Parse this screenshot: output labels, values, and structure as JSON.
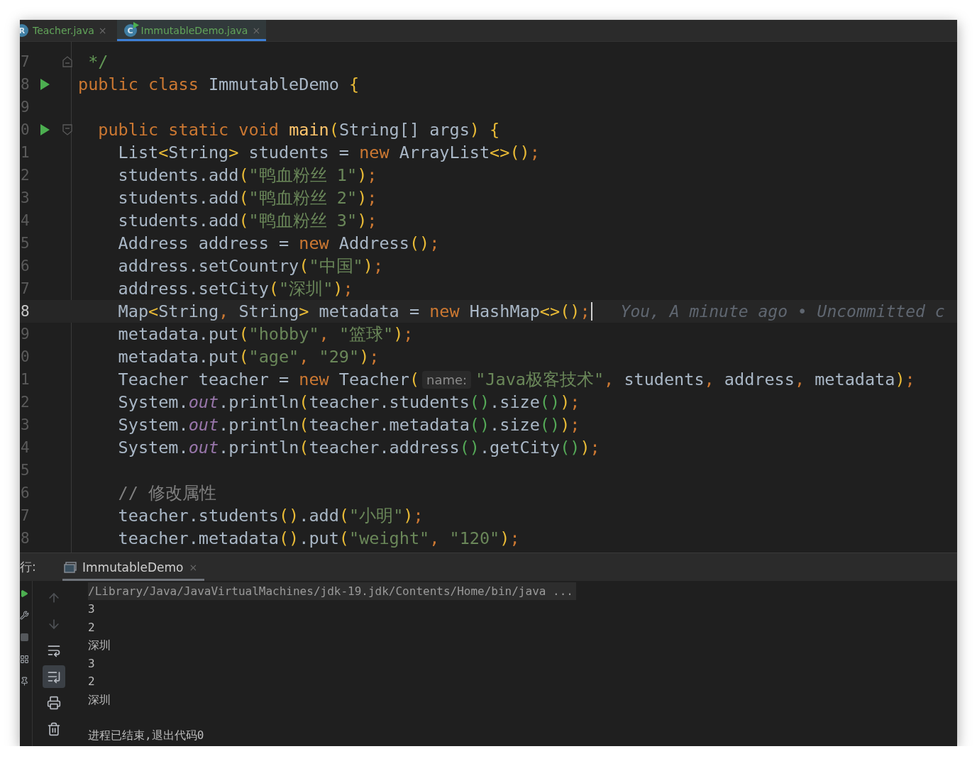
{
  "tabs": [
    {
      "label": "Teacher.java",
      "icon": "R",
      "close": "×",
      "selected": false
    },
    {
      "label": "ImmutableDemo.java",
      "icon": "C",
      "close": "×",
      "selected": true
    }
  ],
  "editor": {
    "lines": [
      {
        "number": "7",
        "run": false,
        "fold_end": true,
        "current": false,
        "cursor": false,
        "tokens": [
          {
            "kind": "doc",
            "text": " */"
          }
        ]
      },
      {
        "number": "8",
        "run": true,
        "current": false,
        "cursor": false,
        "tokens": [
          {
            "kind": "kw",
            "text": "public class "
          },
          {
            "kind": "plain",
            "text": "ImmutableDemo "
          },
          {
            "kind": "br1",
            "text": "{"
          }
        ]
      },
      {
        "number": "9",
        "run": false,
        "current": false,
        "cursor": false
      },
      {
        "number": "0",
        "run": true,
        "fold_start": true,
        "current": false,
        "cursor": false,
        "tokens": [
          {
            "kind": "kw",
            "text": "  public static void "
          },
          {
            "kind": "decl",
            "text": "main"
          },
          {
            "kind": "br1",
            "text": "("
          },
          {
            "kind": "plain",
            "text": "String[] args"
          },
          {
            "kind": "br1",
            "text": ") {"
          }
        ]
      },
      {
        "number": "1",
        "run": false,
        "current": false,
        "cursor": false,
        "tokens": [
          {
            "kind": "plain",
            "text": "    List"
          },
          {
            "kind": "br1",
            "text": "<"
          },
          {
            "kind": "plain",
            "text": "String"
          },
          {
            "kind": "br1",
            "text": ">"
          },
          {
            "kind": "plain",
            "text": " students = "
          },
          {
            "kind": "kw",
            "text": "new "
          },
          {
            "kind": "plain",
            "text": "ArrayList"
          },
          {
            "kind": "br1",
            "text": "<>()"
          },
          {
            "kind": "punct",
            "text": ";"
          }
        ]
      },
      {
        "number": "2",
        "run": false,
        "current": false,
        "cursor": false,
        "tokens": [
          {
            "kind": "plain",
            "text": "    students.add"
          },
          {
            "kind": "br1",
            "text": "("
          },
          {
            "kind": "str",
            "text": "\"鸭血粉丝 1\""
          },
          {
            "kind": "br1",
            "text": ")"
          },
          {
            "kind": "punct",
            "text": ";"
          }
        ]
      },
      {
        "number": "3",
        "run": false,
        "current": false,
        "cursor": false,
        "tokens": [
          {
            "kind": "plain",
            "text": "    students.add"
          },
          {
            "kind": "br1",
            "text": "("
          },
          {
            "kind": "str",
            "text": "\"鸭血粉丝 2\""
          },
          {
            "kind": "br1",
            "text": ")"
          },
          {
            "kind": "punct",
            "text": ";"
          }
        ]
      },
      {
        "number": "4",
        "run": false,
        "current": false,
        "cursor": false,
        "tokens": [
          {
            "kind": "plain",
            "text": "    students.add"
          },
          {
            "kind": "br1",
            "text": "("
          },
          {
            "kind": "str",
            "text": "\"鸭血粉丝 3\""
          },
          {
            "kind": "br1",
            "text": ")"
          },
          {
            "kind": "punct",
            "text": ";"
          }
        ]
      },
      {
        "number": "5",
        "run": false,
        "current": false,
        "cursor": false,
        "tokens": [
          {
            "kind": "plain",
            "text": "    Address address = "
          },
          {
            "kind": "kw",
            "text": "new "
          },
          {
            "kind": "plain",
            "text": "Address"
          },
          {
            "kind": "br1",
            "text": "()"
          },
          {
            "kind": "punct",
            "text": ";"
          }
        ]
      },
      {
        "number": "6",
        "run": false,
        "current": false,
        "cursor": false,
        "tokens": [
          {
            "kind": "plain",
            "text": "    address.setCountry"
          },
          {
            "kind": "br1",
            "text": "("
          },
          {
            "kind": "str",
            "text": "\"中国\""
          },
          {
            "kind": "br1",
            "text": ")"
          },
          {
            "kind": "punct",
            "text": ";"
          }
        ]
      },
      {
        "number": "7",
        "run": false,
        "current": false,
        "cursor": false,
        "tokens": [
          {
            "kind": "plain",
            "text": "    address.setCity"
          },
          {
            "kind": "br1",
            "text": "("
          },
          {
            "kind": "str",
            "text": "\"深圳\""
          },
          {
            "kind": "br1",
            "text": ")"
          },
          {
            "kind": "punct",
            "text": ";"
          }
        ]
      },
      {
        "number": "8",
        "run": false,
        "current": true,
        "cursor": true,
        "blame": "You, A minute ago • Uncommitted c",
        "tokens": [
          {
            "kind": "plain",
            "text": "    Map"
          },
          {
            "kind": "br1",
            "text": "<"
          },
          {
            "kind": "plain",
            "text": "String"
          },
          {
            "kind": "punct",
            "text": ", "
          },
          {
            "kind": "plain",
            "text": "String"
          },
          {
            "kind": "br1",
            "text": ">"
          },
          {
            "kind": "plain",
            "text": " metadata = "
          },
          {
            "kind": "kw",
            "text": "new "
          },
          {
            "kind": "plain",
            "text": "HashMap"
          },
          {
            "kind": "br1",
            "text": "<>()"
          },
          {
            "kind": "punct",
            "text": ";"
          }
        ]
      },
      {
        "number": "9",
        "run": false,
        "current": false,
        "cursor": false,
        "tokens": [
          {
            "kind": "plain",
            "text": "    metadata.put"
          },
          {
            "kind": "br1",
            "text": "("
          },
          {
            "kind": "str",
            "text": "\"hobby\""
          },
          {
            "kind": "punct",
            "text": ", "
          },
          {
            "kind": "str",
            "text": "\"篮球\""
          },
          {
            "kind": "br1",
            "text": ")"
          },
          {
            "kind": "punct",
            "text": ";"
          }
        ]
      },
      {
        "number": "0",
        "run": false,
        "current": false,
        "cursor": false,
        "tokens": [
          {
            "kind": "plain",
            "text": "    metadata.put"
          },
          {
            "kind": "br1",
            "text": "("
          },
          {
            "kind": "str",
            "text": "\"age\""
          },
          {
            "kind": "punct",
            "text": ", "
          },
          {
            "kind": "str",
            "text": "\"29\""
          },
          {
            "kind": "br1",
            "text": ")"
          },
          {
            "kind": "punct",
            "text": ";"
          }
        ]
      },
      {
        "number": "1",
        "run": false,
        "current": false,
        "cursor": false,
        "tokens": [
          {
            "kind": "plain",
            "text": "    Teacher teacher = "
          },
          {
            "kind": "kw",
            "text": "new "
          },
          {
            "kind": "plain",
            "text": "Teacher"
          },
          {
            "kind": "br1",
            "text": "("
          },
          {
            "kind": "hint",
            "text": "name:"
          },
          {
            "kind": "str",
            "text": "\"Java极客技术\""
          },
          {
            "kind": "punct",
            "text": ", "
          },
          {
            "kind": "plain",
            "text": "students"
          },
          {
            "kind": "punct",
            "text": ", "
          },
          {
            "kind": "plain",
            "text": "address"
          },
          {
            "kind": "punct",
            "text": ", "
          },
          {
            "kind": "plain",
            "text": "metadata"
          },
          {
            "kind": "br1",
            "text": ")"
          },
          {
            "kind": "punct",
            "text": ";"
          }
        ]
      },
      {
        "number": "2",
        "run": false,
        "current": false,
        "cursor": false,
        "tokens": [
          {
            "kind": "plain",
            "text": "    System."
          },
          {
            "kind": "static",
            "text": "out"
          },
          {
            "kind": "plain",
            "text": ".println"
          },
          {
            "kind": "br1",
            "text": "("
          },
          {
            "kind": "plain",
            "text": "teacher.students"
          },
          {
            "kind": "br2",
            "text": "()"
          },
          {
            "kind": "plain",
            "text": ".size"
          },
          {
            "kind": "br2",
            "text": "()"
          },
          {
            "kind": "br1",
            "text": ")"
          },
          {
            "kind": "punct",
            "text": ";"
          }
        ]
      },
      {
        "number": "3",
        "run": false,
        "current": false,
        "cursor": false,
        "tokens": [
          {
            "kind": "plain",
            "text": "    System."
          },
          {
            "kind": "static",
            "text": "out"
          },
          {
            "kind": "plain",
            "text": ".println"
          },
          {
            "kind": "br1",
            "text": "("
          },
          {
            "kind": "plain",
            "text": "teacher.metadata"
          },
          {
            "kind": "br2",
            "text": "()"
          },
          {
            "kind": "plain",
            "text": ".size"
          },
          {
            "kind": "br2",
            "text": "()"
          },
          {
            "kind": "br1",
            "text": ")"
          },
          {
            "kind": "punct",
            "text": ";"
          }
        ]
      },
      {
        "number": "4",
        "run": false,
        "current": false,
        "cursor": false,
        "tokens": [
          {
            "kind": "plain",
            "text": "    System."
          },
          {
            "kind": "static",
            "text": "out"
          },
          {
            "kind": "plain",
            "text": ".println"
          },
          {
            "kind": "br1",
            "text": "("
          },
          {
            "kind": "plain",
            "text": "teacher.address"
          },
          {
            "kind": "br2",
            "text": "()"
          },
          {
            "kind": "plain",
            "text": ".getCity"
          },
          {
            "kind": "br2",
            "text": "()"
          },
          {
            "kind": "br1",
            "text": ")"
          },
          {
            "kind": "punct",
            "text": ";"
          }
        ]
      },
      {
        "number": "5",
        "run": false,
        "current": false,
        "cursor": false
      },
      {
        "number": "6",
        "run": false,
        "current": false,
        "cursor": false,
        "tokens": [
          {
            "kind": "comment",
            "text": "    // 修改属性"
          }
        ]
      },
      {
        "number": "7",
        "run": false,
        "current": false,
        "cursor": false,
        "tokens": [
          {
            "kind": "plain",
            "text": "    teacher.students"
          },
          {
            "kind": "br1",
            "text": "()"
          },
          {
            "kind": "plain",
            "text": ".add"
          },
          {
            "kind": "br1",
            "text": "("
          },
          {
            "kind": "str",
            "text": "\"小明\""
          },
          {
            "kind": "br1",
            "text": ")"
          },
          {
            "kind": "punct",
            "text": ";"
          }
        ]
      },
      {
        "number": "8",
        "run": false,
        "current": false,
        "cursor": false,
        "tokens": [
          {
            "kind": "plain",
            "text": "    teacher.metadata"
          },
          {
            "kind": "br1",
            "text": "()"
          },
          {
            "kind": "plain",
            "text": ".put"
          },
          {
            "kind": "br1",
            "text": "("
          },
          {
            "kind": "str",
            "text": "\"weight\""
          },
          {
            "kind": "punct",
            "text": ", "
          },
          {
            "kind": "str",
            "text": "\"120\""
          },
          {
            "kind": "br1",
            "text": ")"
          },
          {
            "kind": "punct",
            "text": ";"
          }
        ]
      }
    ]
  },
  "run_panel": {
    "label": "行:",
    "tab": {
      "label": "ImmutableDemo",
      "close": "×",
      "selected": true
    },
    "toolbar": [
      {
        "kind": "up",
        "disabled": true,
        "selected": false
      },
      {
        "kind": "down",
        "disabled": true,
        "selected": false
      },
      {
        "kind": "wrap",
        "disabled": false,
        "selected": false
      },
      {
        "kind": "scroll-end",
        "disabled": false,
        "selected": true
      },
      {
        "kind": "print",
        "disabled": false,
        "selected": false
      },
      {
        "kind": "trash",
        "disabled": false,
        "selected": false
      }
    ],
    "command": "/Library/Java/JavaVirtualMachines/jdk-19.jdk/Contents/Home/bin/java ...",
    "output": [
      "3",
      "2",
      "深圳",
      "3",
      "2",
      "深圳"
    ],
    "exit_message": "进程已结束,退出代码0"
  }
}
